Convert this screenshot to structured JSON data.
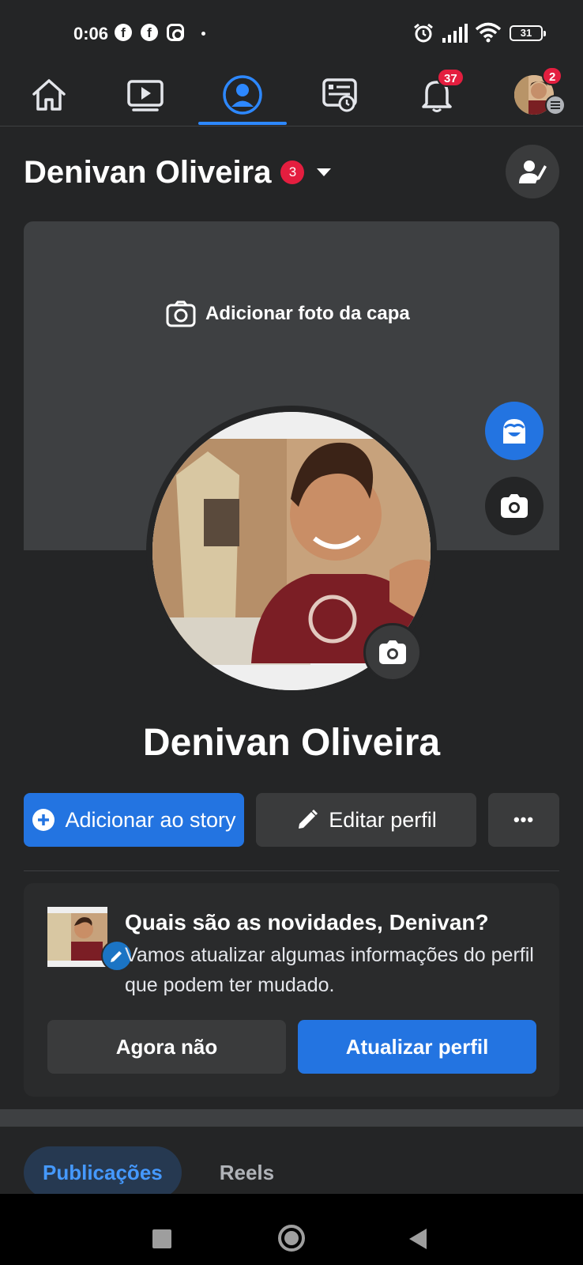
{
  "status_bar": {
    "time": "0:06",
    "notification_icons": [
      "facebook-icon",
      "facebook-icon",
      "instagram-icon"
    ],
    "battery": "31"
  },
  "top_nav": {
    "tabs": [
      "home-icon",
      "watch-icon",
      "profile-icon",
      "feeds-icon",
      "notifications-icon",
      "menu-avatar"
    ],
    "active_tab": "profile-icon",
    "notifications_badge": "37",
    "menu_badge": "2",
    "accent": "#2d88ff"
  },
  "header": {
    "name": "Denivan Oliveira",
    "badge": "3"
  },
  "cover": {
    "add_label": "Adicionar foto da capa"
  },
  "profile": {
    "name": "Denivan Oliveira"
  },
  "actions": {
    "add_story": "Adicionar ao story",
    "edit_profile": "Editar perfil",
    "more": "•••"
  },
  "update_card": {
    "title": "Quais são as novidades, Denivan?",
    "body": "Vamos atualizar algumas informações do perfil que podem ter mudado.",
    "dismiss": "Agora não",
    "confirm": "Atualizar perfil"
  },
  "content_tabs": {
    "active": "Publicações",
    "other": "Reels"
  },
  "colors": {
    "background": "#242526",
    "primary": "#2374e1",
    "badge": "#e41e3f"
  }
}
